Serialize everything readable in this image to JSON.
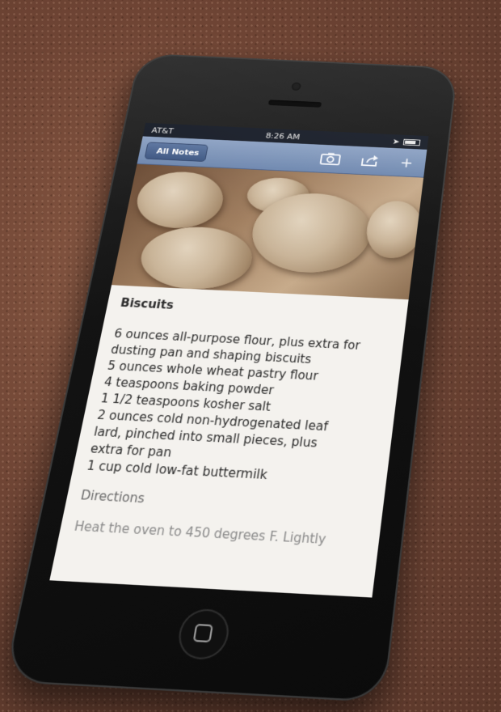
{
  "status_bar": {
    "carrier": "AT&T",
    "time": "8:26 AM"
  },
  "nav": {
    "back_label": "All Notes",
    "camera_icon": "camera-icon",
    "share_icon": "share-icon",
    "add_icon": "plus-icon",
    "add_label": "+"
  },
  "note": {
    "title": "Biscuits",
    "ingredients": [
      "6 ounces all-purpose flour, plus extra for",
      "dusting pan and shaping biscuits",
      "5 ounces whole wheat pastry flour",
      "4 teaspoons baking powder",
      "1 1/2 teaspoons kosher salt",
      "2 ounces cold non-hydrogenated leaf",
      "lard, pinched into small pieces, plus",
      "extra for pan",
      "1 cup cold low-fat buttermilk"
    ],
    "directions_heading": "Directions",
    "directions_text": "Heat the oven to 450 degrees F. Lightly"
  },
  "colors": {
    "nav_bar": "#7a90b6",
    "back_button": "#4b6491",
    "screen_bg": "#f4f2ee",
    "phone_body": "#141414"
  }
}
